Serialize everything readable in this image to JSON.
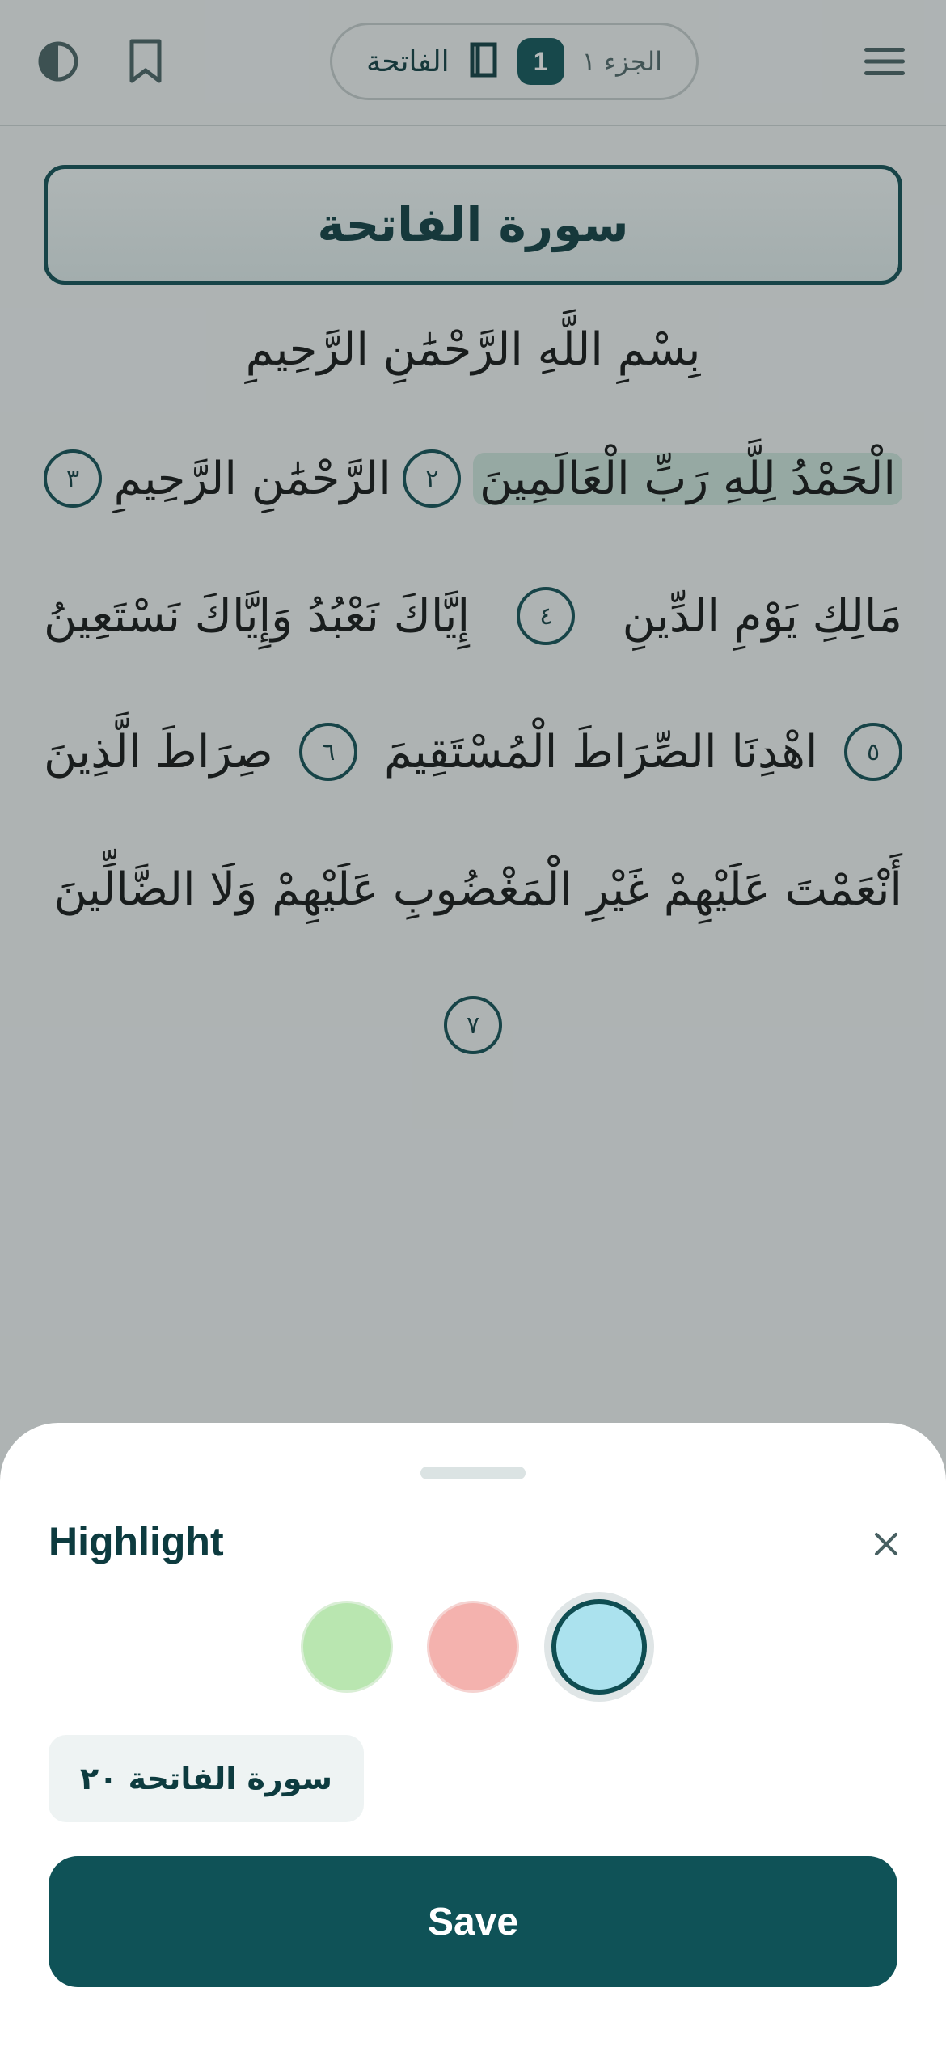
{
  "header": {
    "juz_label": "الجزء ١",
    "page_badge": "1",
    "surah_name": "الفاتحة"
  },
  "reader": {
    "surah_title": "سورة الفاتحة",
    "basmala": "بِسْمِ اللَّهِ الرَّحْمَٰنِ الرَّحِيمِ",
    "lines": [
      [
        {
          "type": "text",
          "text": "الْحَمْدُ لِلَّهِ رَبِّ الْعَالَمِينَ",
          "highlighted": true
        },
        {
          "type": "num",
          "text": "٢"
        },
        {
          "type": "text",
          "text": "الرَّحْمَٰنِ الرَّحِيمِ"
        },
        {
          "type": "num",
          "text": "٣"
        }
      ],
      [
        {
          "type": "text",
          "text": "مَالِكِ يَوْمِ الدِّينِ"
        },
        {
          "type": "num",
          "text": "٤"
        },
        {
          "type": "text",
          "text": "إِيَّاكَ نَعْبُدُ وَإِيَّاكَ نَسْتَعِينُ"
        }
      ],
      [
        {
          "type": "num",
          "text": "٥"
        },
        {
          "type": "text",
          "text": "اهْدِنَا الصِّرَاطَ الْمُسْتَقِيمَ"
        },
        {
          "type": "num",
          "text": "٦"
        },
        {
          "type": "text",
          "text": "صِرَاطَ الَّذِينَ"
        }
      ],
      [
        {
          "type": "text",
          "text": "أَنْعَمْتَ عَلَيْهِمْ غَيْرِ الْمَغْضُوبِ عَلَيْهِمْ وَلَا الضَّالِّينَ"
        }
      ]
    ],
    "final_ayah_number": "٧"
  },
  "sheet": {
    "title": "Highlight",
    "close_icon": "×",
    "colors": [
      {
        "name": "green",
        "hex": "#b9e6b0",
        "selected": false
      },
      {
        "name": "red",
        "hex": "#f4b2ae",
        "selected": false
      },
      {
        "name": "blue",
        "hex": "#abe2ee",
        "selected": true
      }
    ],
    "reference": "سورة الفاتحة ٢٠",
    "save_label": "Save"
  },
  "theme": {
    "accent": "#0f5257",
    "highlight": "#cfe6dd"
  }
}
